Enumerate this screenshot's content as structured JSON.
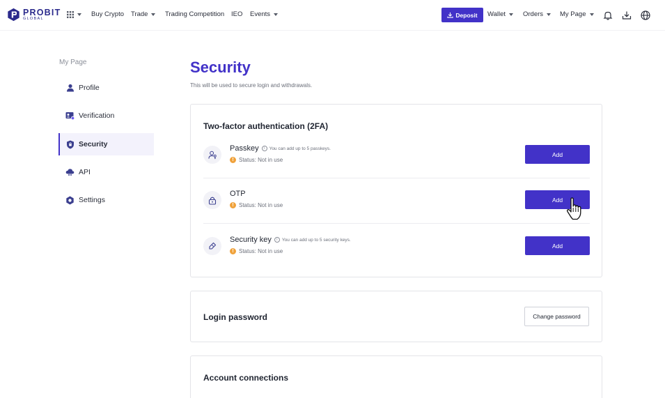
{
  "brand": {
    "name": "PROBIT",
    "sub": "GLOBAL"
  },
  "nav": {
    "buy_crypto": "Buy Crypto",
    "trade": "Trade",
    "trading_competition": "Trading Competition",
    "ieo": "IEO",
    "events": "Events",
    "deposit": "Deposit",
    "wallet": "Wallet",
    "orders": "Orders",
    "my_page": "My Page",
    "icons": [
      "apps-grid-icon",
      "bell-icon",
      "download-icon",
      "globe-icon"
    ]
  },
  "sidebar": {
    "title": "My Page",
    "items": [
      {
        "label": "Profile",
        "icon": "user-icon"
      },
      {
        "label": "Verification",
        "icon": "id-card-icon"
      },
      {
        "label": "Security",
        "icon": "shield-icon",
        "active": true
      },
      {
        "label": "API",
        "icon": "cloud-icon"
      },
      {
        "label": "Settings",
        "icon": "gear-icon"
      }
    ]
  },
  "main": {
    "title": "Security",
    "subtitle": "This will be used to secure login and withdrawals.",
    "twofa": {
      "title": "Two-factor authentication (2FA)",
      "rows": [
        {
          "name": "Passkey",
          "note": "You can add up to 5 passkeys.",
          "status": "Status: Not in use",
          "button": "Add",
          "icon": "passkey-icon"
        },
        {
          "name": "OTP",
          "note": "",
          "status": "Status: Not in use",
          "button": "Add",
          "icon": "lock-icon"
        },
        {
          "name": "Security key",
          "note": "You can add up to 5 security keys.",
          "status": "Status: Not in use",
          "button": "Add",
          "icon": "key-icon"
        }
      ]
    },
    "login_password": {
      "title": "Login password",
      "button": "Change password"
    },
    "account_connections": {
      "title": "Account connections"
    }
  },
  "colors": {
    "accent": "#4232c8",
    "status_warning": "#f0a23b",
    "active_bg": "#f3f2fc"
  }
}
